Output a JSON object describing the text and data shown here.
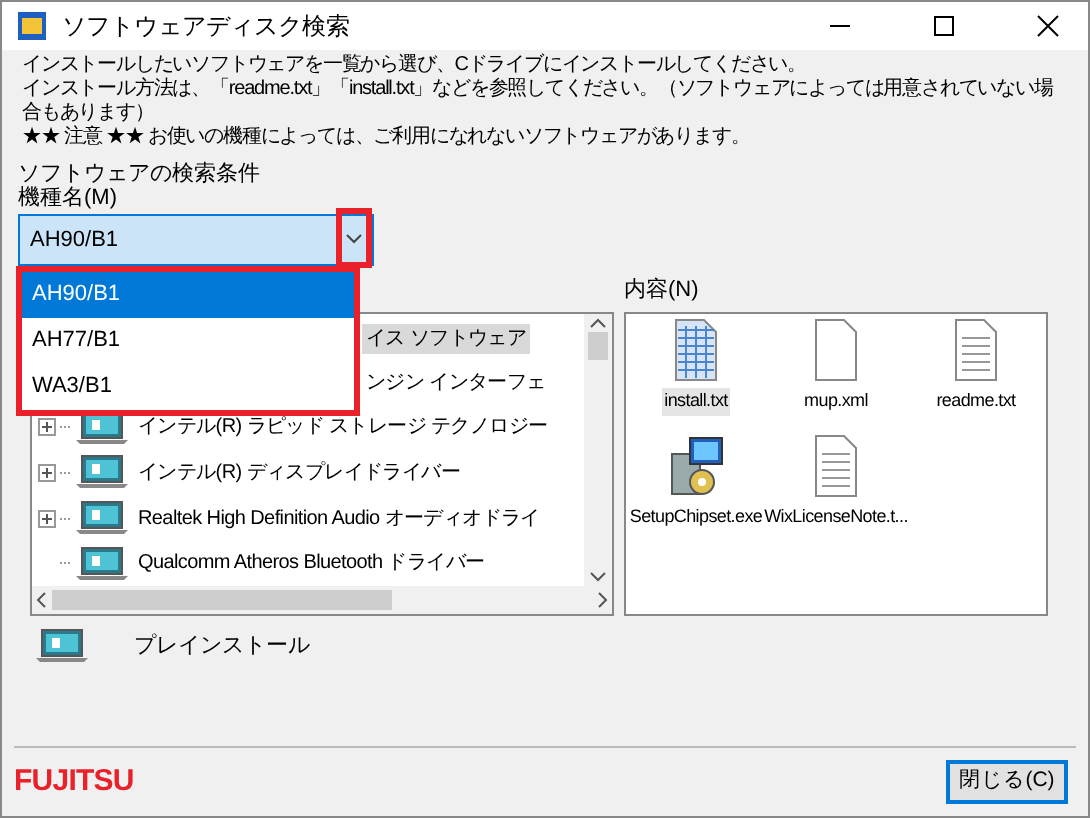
{
  "window": {
    "title": "ソフトウェアディスク検索"
  },
  "instructions": [
    "インストールしたいソフトウェアを一覧から選び、Cドライブにインストールしてください。",
    "インストール方法は、「readme.txt」「install.txt」などを参照してください。（ソフトウェアによっては用意されていない場合もあります）",
    "★★ 注意 ★★ お使いの機種によっては、ご利用になれないソフトウェアがあります。"
  ],
  "search": {
    "heading": "ソフトウェアの検索条件",
    "model_label": "機種名(M)",
    "model_value": "AH90/B1",
    "dropdown_open": true,
    "options": [
      {
        "label": "AH90/B1",
        "selected": true
      },
      {
        "label": "AH77/B1",
        "selected": false
      },
      {
        "label": "WA3/B1",
        "selected": false
      }
    ]
  },
  "tree": {
    "items": [
      {
        "kind": "cut",
        "label": "イス ソフトウェア",
        "selected": true
      },
      {
        "kind": "cut",
        "label": "ンジン インターフェ",
        "selected": false
      },
      {
        "kind": "item",
        "label": "インテル(R) ラピッド ストレージ テクノロジー",
        "selected": false,
        "expandable": true
      },
      {
        "kind": "item",
        "label": "インテル(R) ディスプレイドライバー",
        "selected": false,
        "expandable": true
      },
      {
        "kind": "item",
        "label": "Realtek High Definition Audio オーディオドライ",
        "selected": false,
        "expandable": true
      },
      {
        "kind": "item",
        "label": "Qualcomm Atheros Bluetooth ドライバー",
        "selected": false,
        "expandable": false
      }
    ]
  },
  "contents": {
    "label": "内容(N)",
    "files": [
      {
        "kind": "grid",
        "name": "install.txt",
        "selected": true
      },
      {
        "kind": "blank",
        "name": "mup.xml",
        "selected": false
      },
      {
        "kind": "lines",
        "name": "readme.txt",
        "selected": false
      },
      {
        "kind": "installer",
        "name": "SetupChipset.exe",
        "selected": false
      },
      {
        "kind": "lines",
        "name": "WixLicenseNote.t...",
        "selected": false
      }
    ]
  },
  "legend": {
    "label": "プレインストール"
  },
  "footer": {
    "logo": "FUJITSU",
    "close_button": "閉じる(C)"
  }
}
